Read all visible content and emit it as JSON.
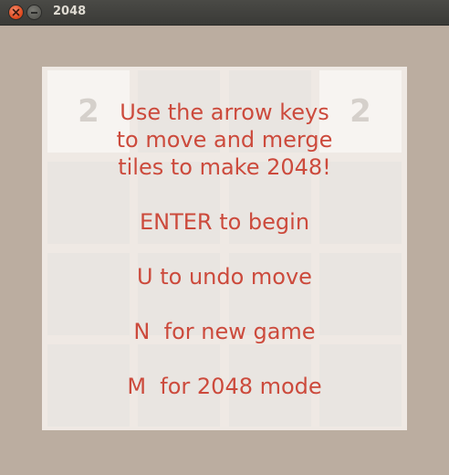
{
  "window": {
    "title": "2048"
  },
  "board": {
    "tiles": [
      {
        "row": 0,
        "col": 0,
        "value": "2"
      },
      {
        "row": 0,
        "col": 3,
        "value": "2"
      }
    ]
  },
  "overlay": {
    "lines": [
      "Use the arrow keys",
      "to move and merge",
      "tiles to make 2048!",
      "ENTER to begin",
      "U to undo move",
      "N  for new game",
      "M  for 2048 mode"
    ]
  },
  "colors": {
    "background": "#bbada0",
    "board": "#efe9e4",
    "empty_cell": "#e9e5e1",
    "tile_2": "#f7f4f1",
    "tile_text": "#d5d0cb",
    "overlay_text": "#cc4a3c"
  }
}
